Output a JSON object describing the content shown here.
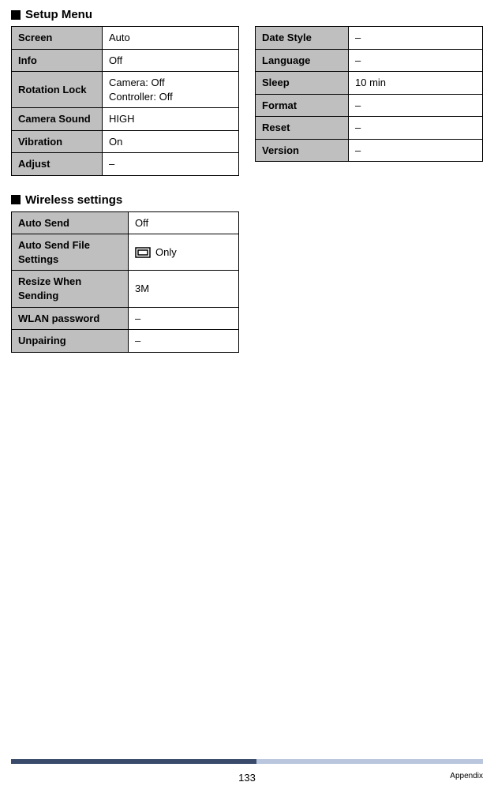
{
  "sections": {
    "setup_menu": {
      "title": "Setup Menu",
      "left_rows": [
        {
          "label": "Screen",
          "value": "Auto"
        },
        {
          "label": "Info",
          "value": "Off"
        },
        {
          "label": "Rotation Lock",
          "value": "Camera: Off\nController: Off"
        },
        {
          "label": "Camera Sound",
          "value": "HIGH"
        },
        {
          "label": "Vibration",
          "value": "On"
        },
        {
          "label": "Adjust",
          "value": "–"
        }
      ],
      "right_rows": [
        {
          "label": "Date Style",
          "value": "–"
        },
        {
          "label": "Language",
          "value": "–"
        },
        {
          "label": "Sleep",
          "value": "10 min"
        },
        {
          "label": "Format",
          "value": "–"
        },
        {
          "label": "Reset",
          "value": "–"
        },
        {
          "label": "Version",
          "value": "–"
        }
      ]
    },
    "wireless": {
      "title": "Wireless settings",
      "rows": [
        {
          "label": "Auto Send",
          "value": "Off",
          "has_icon": false
        },
        {
          "label": "Auto Send File Settings",
          "value": "Only",
          "has_icon": true
        },
        {
          "label": "Resize When Sending",
          "value": "3M",
          "has_icon": false
        },
        {
          "label": "WLAN password",
          "value": "–",
          "has_icon": false
        },
        {
          "label": "Unpairing",
          "value": "–",
          "has_icon": false
        }
      ]
    }
  },
  "footer": {
    "page_number": "133",
    "section_label": "Appendix"
  }
}
